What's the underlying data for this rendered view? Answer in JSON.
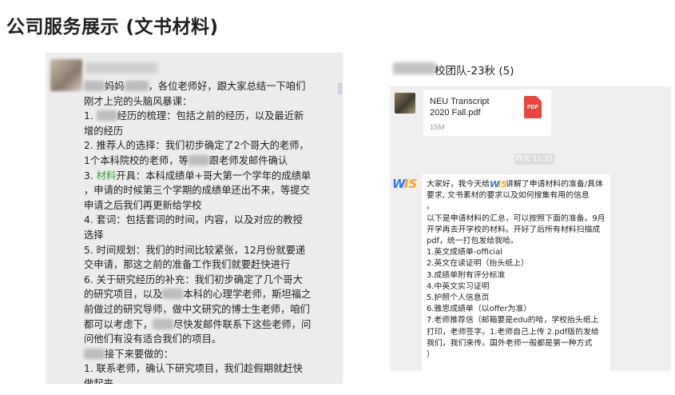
{
  "page": {
    "title": "公司服务展示 (文书材料)"
  },
  "left_chat": {
    "lines": [
      {
        "pre": "",
        "blur": true,
        "post": "妈妈",
        "blur2": true,
        "tail": "，各位老师好，跟大家总结一下咱们"
      },
      {
        "text": "刚才上完的头脑风暴课："
      },
      {
        "pre": "1. ",
        "blur": true,
        "post": "经历的梳理：包括之前的经历，以及最近新"
      },
      {
        "text": "增的经历"
      },
      {
        "text": "2. 推荐人的选择：我们初步确定了2个哥大的老师，"
      },
      {
        "pre": "1个本科院校的老师，等",
        "blur": true,
        "post": "跟老师发邮件确认"
      },
      {
        "green_pre": "3. ",
        "green": "材料",
        "green_post": "开具：本科成绩单+哥大第一个学年的成绩单"
      },
      {
        "text": "，申请的时候第三个学期的成绩单还出不来，等提交"
      },
      {
        "text": "申请之后我们再更新给学校"
      },
      {
        "text": "4. 套词：包括套词的时间，内容，以及对应的教授"
      },
      {
        "text": "选择"
      },
      {
        "text": "5. 时间规划：我们的时间比较紧张，12月份就要递"
      },
      {
        "text": "交申请，那这之前的准备工作我们就要赶快进行"
      },
      {
        "text": "6. 关于研究经历的补充：我们初步确定了几个哥大"
      },
      {
        "pre": "的研究项目，以及",
        "blur": true,
        "post": "本科的心理学老师，斯坦福之"
      },
      {
        "text": "前做过的研究导师，做中文研究的博士生老师，咱们"
      },
      {
        "pre": "都可以考虑下，",
        "blur": true,
        "post": "尽快发邮件联系下这些老师，问"
      },
      {
        "text": "问他们有没有适合我们的项目。"
      },
      {
        "pre": "",
        "blur": true,
        "post": "接下来要做的："
      },
      {
        "text": "1. 联系老师，确认下研究项目，我们趁假期就赶快"
      },
      {
        "text": "做起来"
      }
    ]
  },
  "right_chat": {
    "group_title": "校团队-23秋 (5)",
    "file": {
      "name": "NEU Transcript 2020 Fall.pdf",
      "size": "15M",
      "icon": "pdf-icon",
      "icon_label": "PDF"
    },
    "timestamp": "昨天 11:31",
    "avatar_label": "WIS",
    "message": {
      "intro_pre": "大家好，我今天给",
      "intro_post": "讲解了申请材料的准备/具体要求, 文书素材的要求以及如何搜集有用的信息",
      "dot": "。",
      "lines": [
        "以下是申请材料的汇总，可以按照下面的准备。9月开学再去开学校的材料。开好了后所有材料扫描成pdf，统一打包发给我哈。",
        "1.英文成绩单-official",
        "2.英文在读证明（抬头纸上）",
        "3.成绩单附有评分标准",
        "4.中英文实习证明",
        "5.护照个人信息页",
        "6.雅思成绩单（以offer为准）",
        "7.老师推荐信（邮箱要是edu的哈，学校抬头纸上打印，老师签字。1.老师自己上传 2.pdf版的发给我们，我们来传。国外老师一般都是第一种方式",
        "）"
      ]
    }
  },
  "colors": {
    "accent_green": "#3aa03a",
    "pdf_red": "#e8453c",
    "wis_blue": "#2f7de1",
    "wis_orange": "#f5a623"
  }
}
